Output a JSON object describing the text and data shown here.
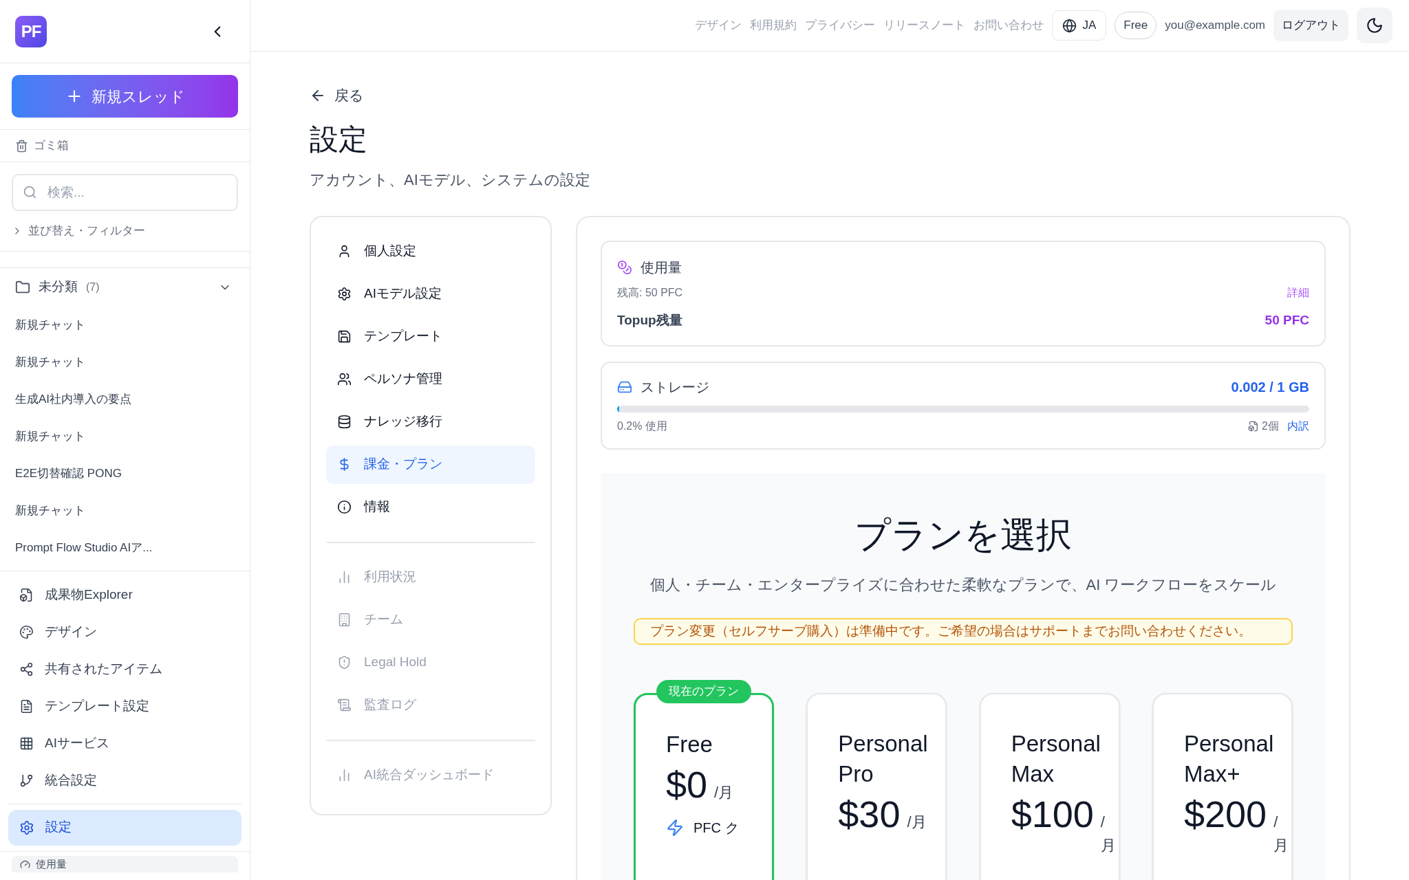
{
  "sidebar": {
    "logo": "PF",
    "new_thread_button": "新規スレッド",
    "trash": "ゴミ箱",
    "search": {
      "placeholder": "検索..."
    },
    "sort_filter": {
      "label": "並び替え・フィルター",
      "expanded": false
    },
    "folder": {
      "name": "未分類",
      "count": "(7)",
      "expanded": true,
      "chats": [
        {
          "title": "新規チャット"
        },
        {
          "title": "新規チャット"
        },
        {
          "title": "生成AI社内導入の要点"
        },
        {
          "title": "新規チャット"
        },
        {
          "title": "E2E切替確認 PONG"
        },
        {
          "title": "新規チャット"
        },
        {
          "title": "Prompt Flow Studio AIア..."
        }
      ]
    },
    "nav": [
      {
        "label": "成果物Explorer",
        "selected": false
      },
      {
        "label": "デザイン",
        "selected": false
      },
      {
        "label": "共有されたアイテム",
        "selected": false
      },
      {
        "label": "テンプレート設定",
        "selected": false
      },
      {
        "label": "AIサービス",
        "selected": false
      },
      {
        "label": "統合設定",
        "selected": false
      }
    ],
    "settings_item": {
      "label": "設定",
      "selected": true
    },
    "usage_peek": "使用量"
  },
  "top_bar": {
    "links": [
      "デザイン",
      "利用規約",
      "プライバシー",
      "リリースノート",
      "お問い合わせ"
    ],
    "language": "JA",
    "plan": "Free",
    "email": "you@example.com",
    "logout": "ログアウト"
  },
  "page": {
    "back": "戻る",
    "title": "設定",
    "subtitle": "アカウント、AIモデル、システムの設定"
  },
  "settings_nav": {
    "groups": [
      {
        "items": [
          {
            "label": "個人設定",
            "selected": false,
            "disabled": false
          },
          {
            "label": "AIモデル設定",
            "selected": false,
            "disabled": false
          },
          {
            "label": "テンプレート",
            "selected": false,
            "disabled": false
          },
          {
            "label": "ペルソナ管理",
            "selected": false,
            "disabled": false
          },
          {
            "label": "ナレッジ移行",
            "selected": false,
            "disabled": false
          },
          {
            "label": "課金・プラン",
            "selected": true,
            "disabled": false
          },
          {
            "label": "情報",
            "selected": false,
            "disabled": false
          }
        ]
      },
      {
        "items": [
          {
            "label": "利用状況",
            "selected": false,
            "disabled": true
          },
          {
            "label": "チーム",
            "selected": false,
            "disabled": true
          },
          {
            "label": "Legal Hold",
            "selected": false,
            "disabled": true
          },
          {
            "label": "監査ログ",
            "selected": false,
            "disabled": true
          }
        ]
      },
      {
        "items": [
          {
            "label": "AI統合ダッシュボード",
            "selected": false,
            "disabled": true
          }
        ]
      }
    ]
  },
  "usage": {
    "title": "使用量",
    "balance": "残高: 50 PFC",
    "detail_link": "詳細",
    "topup_label": "Topup残量",
    "topup_value": "50 PFC"
  },
  "storage": {
    "title": "ストレージ",
    "value": "0.002 / 1 GB",
    "level": 0.002,
    "used": "0.2% 使用",
    "files": "2個",
    "breakdown_link": "内訳"
  },
  "plans": {
    "title": "プランを選択",
    "subtitle": "個人・チーム・エンタープライズに合わせた柔軟なプランで、AI ワークフローをスケール",
    "notice": "プラン変更（セルフサーブ購入）は準備中です。ご希望の場合はサポートまでお問い合わせください。",
    "items": [
      {
        "name": "Free",
        "price": "$0",
        "period": "/月",
        "current": true,
        "badge": "現在のプラン",
        "features": [
          "PFC ク"
        ]
      },
      {
        "name": "Personal Pro",
        "price": "$30",
        "period": "/月",
        "current": false
      },
      {
        "name": "Personal Max",
        "price": "$100",
        "period": "/月",
        "current": false
      },
      {
        "name": "Personal Max+",
        "price": "$200",
        "period": "/月",
        "current": false
      }
    ]
  }
}
